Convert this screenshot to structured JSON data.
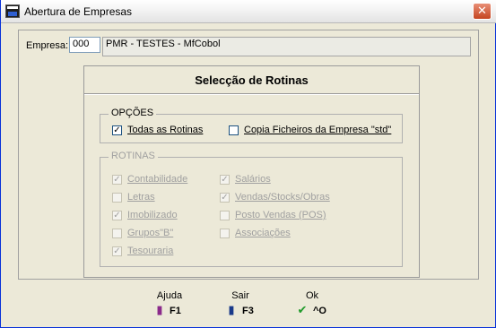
{
  "window": {
    "title": "Abertura de Empresas",
    "close_glyph": "✕"
  },
  "empresa": {
    "label": "Empresa:",
    "code": "000",
    "name": "PMR - TESTES - MfCobol"
  },
  "rotinas_panel": {
    "title": "Selecção de Rotinas"
  },
  "opcoes": {
    "legend": "OPÇÕES",
    "items": [
      {
        "label": "Todas as Rotinas",
        "checked": true
      },
      {
        "label": "Copia Ficheiros da Empresa \"std\"",
        "checked": false
      }
    ]
  },
  "rotinas": {
    "legend": "ROTINAS",
    "left": [
      {
        "label": "Contabilidade",
        "checked": true
      },
      {
        "label": "Letras",
        "checked": false
      },
      {
        "label": "Imobilizado",
        "checked": true
      },
      {
        "label": "Grupos\"B\"",
        "checked": false
      },
      {
        "label": "Tesouraria",
        "checked": true
      }
    ],
    "right": [
      {
        "label": "Salários",
        "checked": true
      },
      {
        "label": "Vendas/Stocks/Obras",
        "checked": true
      },
      {
        "label": "Posto Vendas (POS)",
        "checked": false
      },
      {
        "label": "Associações",
        "checked": false
      }
    ]
  },
  "buttons": {
    "ajuda": {
      "label": "Ajuda",
      "key": "F1",
      "icon": "book-icon"
    },
    "sair": {
      "label": "Sair",
      "key": "F3",
      "icon": "exit-door-icon"
    },
    "ok": {
      "label": "Ok",
      "key": "^O",
      "icon": "checkmark-icon"
    }
  },
  "check_glyph": "✓"
}
